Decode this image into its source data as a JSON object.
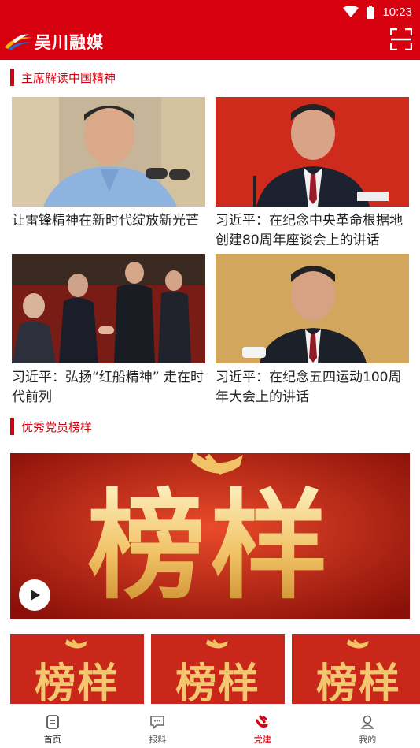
{
  "status": {
    "time": "10:23"
  },
  "header": {
    "app_title": "吴川融媒"
  },
  "sections": [
    {
      "title": "主席解读中国精神"
    },
    {
      "title": "优秀党员榜样"
    }
  ],
  "articles": [
    {
      "title": "让雷锋精神在新时代绽放新光芒"
    },
    {
      "title": "习近平：在纪念中央革命根据地创建80周年座谈会上的讲话"
    },
    {
      "title": "习近平：弘扬“红船精神” 走在时代前列"
    },
    {
      "title": "习近平：在纪念五四运动100周年大会上的讲话"
    }
  ],
  "banner": {
    "text": "榜样"
  },
  "mini_cards": [
    {
      "text": "榜样"
    },
    {
      "text": "榜样"
    },
    {
      "text": "榜样"
    }
  ],
  "nav": {
    "items": [
      {
        "label": "首页",
        "icon": "home-icon"
      },
      {
        "label": "报料",
        "icon": "chat-icon"
      },
      {
        "label": "党建",
        "icon": "party-emblem-icon"
      },
      {
        "label": "我的",
        "icon": "user-icon"
      }
    ],
    "active_index": 2
  },
  "colors": {
    "brand": "#d7000f",
    "text": "#222222"
  }
}
